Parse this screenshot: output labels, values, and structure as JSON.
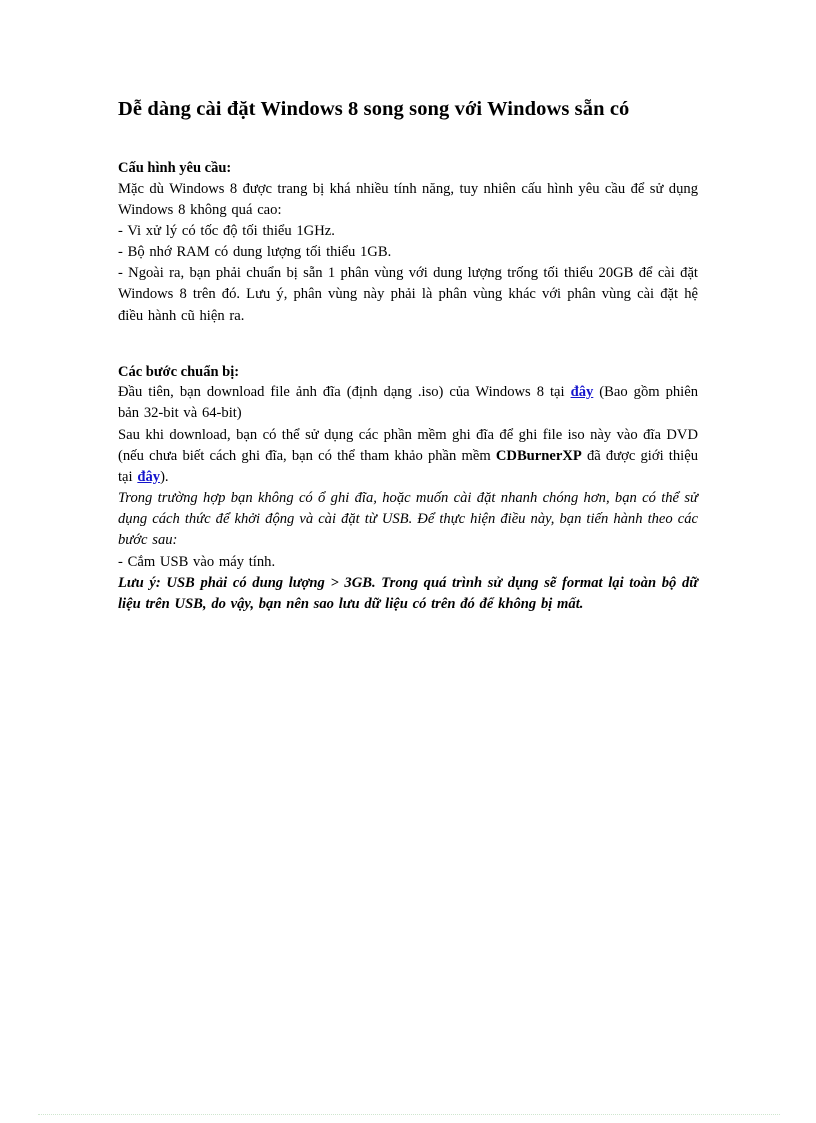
{
  "document": {
    "title": "Dễ dàng cài đặt Windows 8 song song với Windows sẵn có",
    "heading_requirements": "Cấu hình yêu cầu:",
    "intro_paragraph": "Mặc dù Windows 8 được trang bị khá nhiều tính năng, tuy nhiên cấu hình yêu cầu để sử dụng Windows 8 không quá cao:",
    "requirement_cpu": "- Vi xử lý có tốc độ tối thiểu 1GHz.",
    "requirement_ram": "- Bộ nhớ RAM có dung lượng tối thiểu 1GB.",
    "requirement_partition": "- Ngoài ra, bạn phải chuẩn bị sẵn 1 phân vùng với dung lượng trống tối thiểu 20GB để cài đặt Windows 8 trên đó. Lưu ý, phân vùng này phải là phân vùng khác với phân vùng cài đặt hệ điều hành cũ hiện ra.",
    "heading_steps": "Các bước chuẩn bị:",
    "download_paragraph": {
      "before_link": "Đầu tiên, bạn download file ảnh đĩa (định dạng .iso) của Windows 8 tại ",
      "link_text": "đây",
      "after_link": " (Bao gồm phiên bản 32-bit và 64-bit)"
    },
    "burn_paragraph": {
      "part1": "Sau khi download, bạn có thể sử dụng các phần mềm ghi đĩa để ghi file iso này vào đĩa DVD (nếu chưa biết cách ghi đĩa, bạn có thể tham khảo phần mềm ",
      "software_name": "CDBurnerXP",
      "part2": " đã được giới thiệu tại ",
      "link_text": "đây",
      "part3": ")."
    },
    "usb_italic_paragraph": "Trong trường hợp bạn không có ổ ghi đĩa, hoặc muốn cài đặt nhanh chóng hơn, bạn có thể sử dụng cách thức để khởi động và cài đặt từ USB. Để thực hiện điều này, bạn tiến hành theo các bước sau:",
    "step_plug_usb": "- Cắm USB vào máy tính.",
    "warning_note": "Lưu ý: USB phải có dung lượng > 3GB. Trong quá trình sử dụng sẽ format lại toàn bộ dữ liệu trên USB, do vậy, bạn nên sao lưu dữ liệu có trên đó để không bị mất."
  },
  "colors": {
    "link": "#1414cc",
    "text": "#000000",
    "page_background": "#ffffff",
    "footer_rule": "#cfe6cf"
  }
}
